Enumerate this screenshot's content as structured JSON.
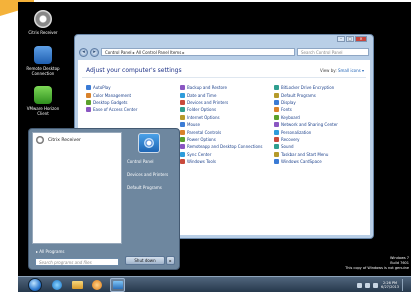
{
  "desktop": {
    "icons": [
      {
        "label": "Citrix Receiver"
      },
      {
        "label": "Remote Desktop Connection"
      },
      {
        "label": "VMware Horizon Client"
      }
    ]
  },
  "control_panel": {
    "address": "Control Panel  ▸  All Control Panel Items  ▸",
    "search_placeholder": "Search Control Panel",
    "heading": "Adjust your computer's settings",
    "view_by_label": "View by:",
    "view_by_value": "Small icons ▾",
    "columns": [
      [
        "AutoPlay",
        "Color Management",
        "Desktop Gadgets",
        "Ease of Access Center",
        "",
        "",
        "",
        "",
        "",
        "",
        ""
      ],
      [
        "Backup and Restore",
        "Date and Time",
        "Devices and Printers",
        "Folder Options",
        "Internet Options",
        "Mouse",
        "Parental Controls",
        "Power Options",
        "Remoteapp and Desktop Connections",
        "Sync Center",
        "Windows Tools"
      ],
      [
        "BitLocker Drive Encryption",
        "Default Programs",
        "Display",
        "Fonts",
        "Keyboard",
        "Network and Sharing Center",
        "Personalization",
        "Recovery",
        "Sound",
        "Taskbar and Start Menu",
        "Windows CardSpace"
      ]
    ]
  },
  "start_menu": {
    "pinned_item": "Citrix Receiver",
    "right_items": [
      "Control Panel",
      "Devices and Printers",
      "Default Programs"
    ],
    "all_programs": "▸  All Programs",
    "search_placeholder": "Search programs and files",
    "shutdown_label": "Shut down",
    "shutdown_arrow": "▸"
  },
  "taskbar": {
    "clock_time": "2:26 PM",
    "clock_date": "6/27/2013"
  },
  "watermark": {
    "line1": "Windows 7",
    "line2": "Build 7601",
    "line3": "This copy of Windows is not genuine"
  }
}
